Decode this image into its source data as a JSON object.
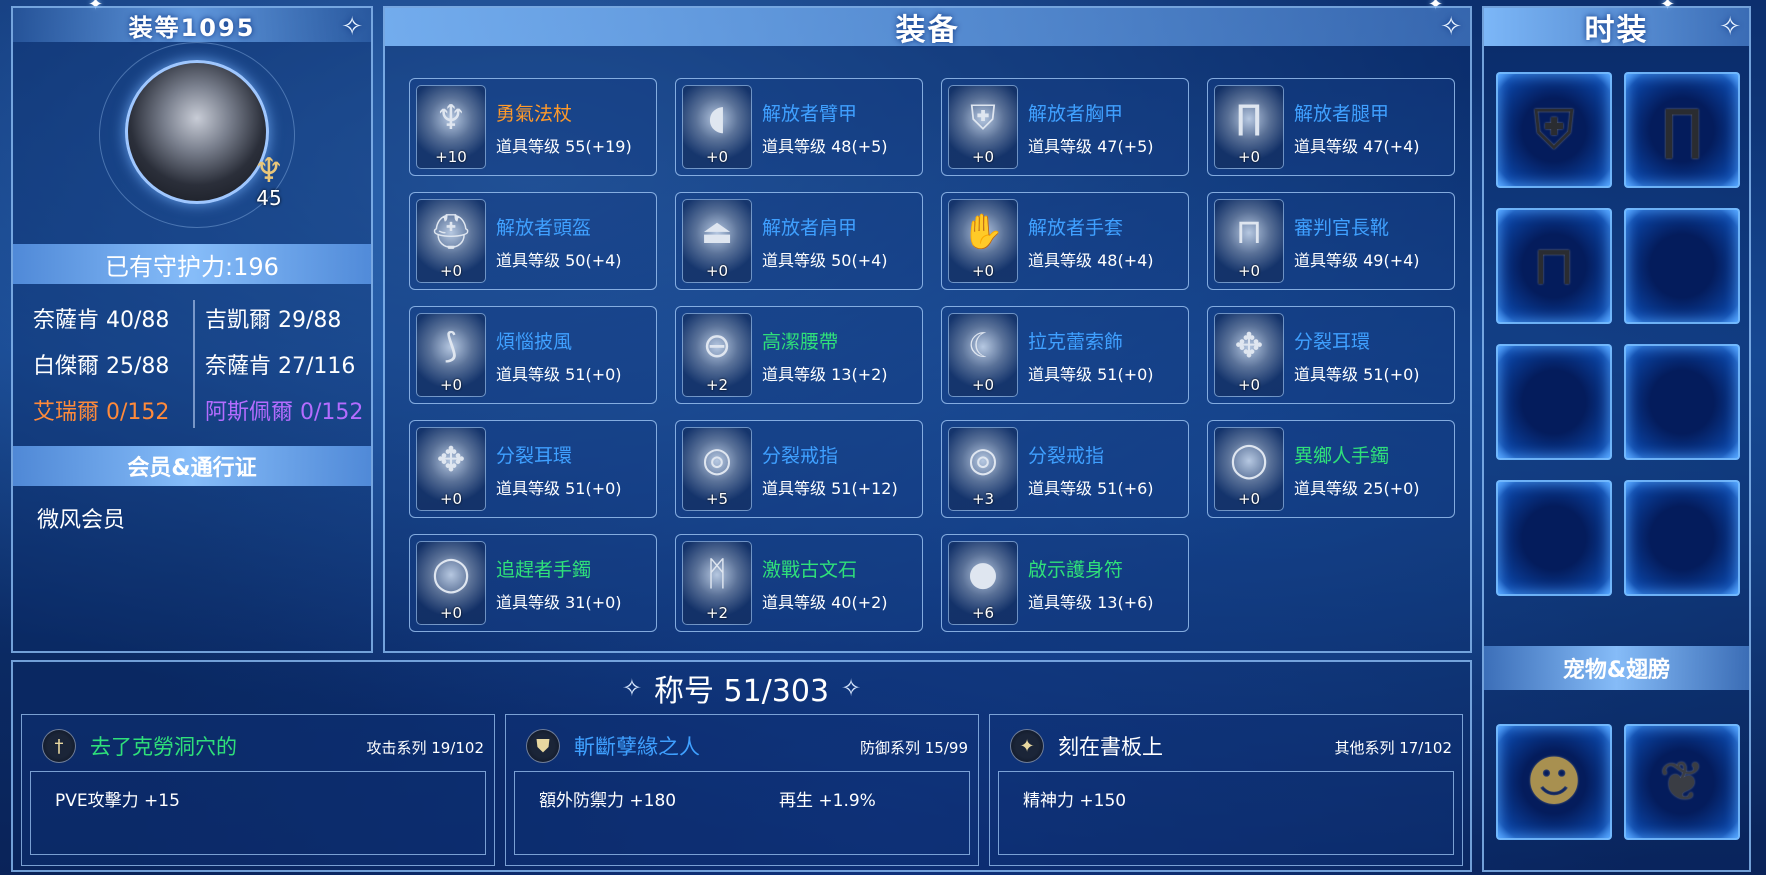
{
  "colors": {
    "name_orange": "#ff9a2a",
    "name_blue": "#3fa0ff",
    "name_green": "#2fe07a",
    "name_gold": "#ffb020",
    "name_purple": "#b46cff"
  },
  "profile": {
    "title": "装等1095",
    "level": "45",
    "guard_power": "已有守护力:196",
    "stats": [
      {
        "label": "奈薩肯 40/88",
        "color": "#ffffff"
      },
      {
        "label": "吉凱爾 29/88",
        "color": "#ffffff"
      },
      {
        "label": "白傑爾 25/88",
        "color": "#ffffff"
      },
      {
        "label": "奈薩肯 27/116",
        "color": "#ffffff"
      },
      {
        "label": "艾瑞爾 0/152",
        "color": "#ff8a3a"
      },
      {
        "label": "阿斯佩爾 0/152",
        "color": "#b46cff"
      }
    ],
    "membership_header": "会员&通行证",
    "membership": "微风会员"
  },
  "equipment": {
    "title": "装备",
    "items": [
      {
        "name": "勇氣法杖",
        "level": "道具等级 55(+19)",
        "plus": "+10",
        "icon": "staff-icon",
        "glyph": "♆",
        "color": "#ff9a2a"
      },
      {
        "name": "解放者臂甲",
        "level": "道具等级 48(+5)",
        "plus": "+0",
        "icon": "arm-guard-icon",
        "glyph": "◖",
        "color": "#3fa0ff"
      },
      {
        "name": "解放者胸甲",
        "level": "道具等级 47(+5)",
        "plus": "+0",
        "icon": "chest-armor-icon",
        "glyph": "⛨",
        "color": "#3fa0ff"
      },
      {
        "name": "解放者腿甲",
        "level": "道具等级 47(+4)",
        "plus": "+0",
        "icon": "leg-armor-icon",
        "glyph": "∏",
        "color": "#3fa0ff"
      },
      {
        "name": "解放者頭盔",
        "level": "道具等级 50(+4)",
        "plus": "+0",
        "icon": "helmet-icon",
        "glyph": "⛑",
        "color": "#3fa0ff"
      },
      {
        "name": "解放者肩甲",
        "level": "道具等级 50(+4)",
        "plus": "+0",
        "icon": "shoulder-armor-icon",
        "glyph": "⏏",
        "color": "#3fa0ff"
      },
      {
        "name": "解放者手套",
        "level": "道具等级 48(+4)",
        "plus": "+0",
        "icon": "gloves-icon",
        "glyph": "✋",
        "color": "#3fa0ff"
      },
      {
        "name": "審判官長靴",
        "level": "道具等级 49(+4)",
        "plus": "+0",
        "icon": "boots-icon",
        "glyph": "⊓",
        "color": "#3fa0ff"
      },
      {
        "name": "煩惱披風",
        "level": "道具等级 51(+0)",
        "plus": "+0",
        "icon": "cape-icon",
        "glyph": "⟆",
        "color": "#3fa0ff"
      },
      {
        "name": "高潔腰帶",
        "level": "道具等级 13(+2)",
        "plus": "+2",
        "icon": "belt-icon",
        "glyph": "⊖",
        "color": "#2fe07a"
      },
      {
        "name": "拉克蕾索飾",
        "level": "道具等级 51(+0)",
        "plus": "+0",
        "icon": "necklace-icon",
        "glyph": "☾",
        "color": "#3fa0ff"
      },
      {
        "name": "分裂耳環",
        "level": "道具等级 51(+0)",
        "plus": "+0",
        "icon": "earring-icon",
        "glyph": "✥",
        "color": "#3fa0ff"
      },
      {
        "name": "分裂耳環",
        "level": "道具等级 51(+0)",
        "plus": "+0",
        "icon": "earring-icon",
        "glyph": "✥",
        "color": "#3fa0ff"
      },
      {
        "name": "分裂戒指",
        "level": "道具等级 51(+12)",
        "plus": "+5",
        "icon": "ring-icon",
        "glyph": "◎",
        "color": "#3fa0ff"
      },
      {
        "name": "分裂戒指",
        "level": "道具等级 51(+6)",
        "plus": "+3",
        "icon": "ring-icon",
        "glyph": "◎",
        "color": "#3fa0ff"
      },
      {
        "name": "異鄉人手鐲",
        "level": "道具等级 25(+0)",
        "plus": "+0",
        "icon": "bracelet-icon",
        "glyph": "◯",
        "color": "#2fe07a"
      },
      {
        "name": "追趕者手鐲",
        "level": "道具等级 31(+0)",
        "plus": "+0",
        "icon": "bracelet-icon",
        "glyph": "◯",
        "color": "#2fe07a"
      },
      {
        "name": "激戰古文石",
        "level": "道具等级 40(+2)",
        "plus": "+2",
        "icon": "rune-stone-icon",
        "glyph": "ᛗ",
        "color": "#2fe07a"
      },
      {
        "name": "啟示護身符",
        "level": "道具等级 13(+6)",
        "plus": "+6",
        "icon": "amulet-icon",
        "glyph": "●",
        "color": "#2fe07a"
      }
    ]
  },
  "fashion": {
    "title": "时装",
    "slots": [
      {
        "icon": "costume-top-icon",
        "glyph": "⛨"
      },
      {
        "icon": "costume-pants-icon",
        "glyph": "∏"
      },
      {
        "icon": "costume-boots-icon",
        "glyph": "⊓"
      },
      {
        "icon": "empty-slot-icon",
        "glyph": ""
      },
      {
        "icon": "empty-slot-icon",
        "glyph": ""
      },
      {
        "icon": "empty-slot-icon",
        "glyph": ""
      },
      {
        "icon": "empty-slot-icon",
        "glyph": ""
      },
      {
        "icon": "empty-slot-icon",
        "glyph": ""
      }
    ],
    "pet_header": "宠物&翅膀",
    "pets": [
      {
        "icon": "pet-ogre-icon",
        "glyph": "☻"
      },
      {
        "icon": "wings-icon",
        "glyph": "❦"
      }
    ]
  },
  "titles": {
    "header": "称号 51/303",
    "cards": [
      {
        "name": "去了克勞洞穴的",
        "series": "攻击系列 19/102",
        "color": "#2fe07a",
        "badge": "sword-icon",
        "glyph": "†",
        "attrs": [
          "PVE攻擊力 +15"
        ]
      },
      {
        "name": "斬斷孽緣之人",
        "series": "防御系列 15/99",
        "color": "#3fa0ff",
        "badge": "shield-icon",
        "glyph": "⛊",
        "attrs": [
          "額外防禦力 +180",
          "再生 +1.9%"
        ]
      },
      {
        "name": "刻在書板上",
        "series": "其他系列 17/102",
        "color": "#ffffff",
        "badge": "star-icon",
        "glyph": "✦",
        "attrs": [
          "精神力 +150"
        ]
      }
    ]
  }
}
